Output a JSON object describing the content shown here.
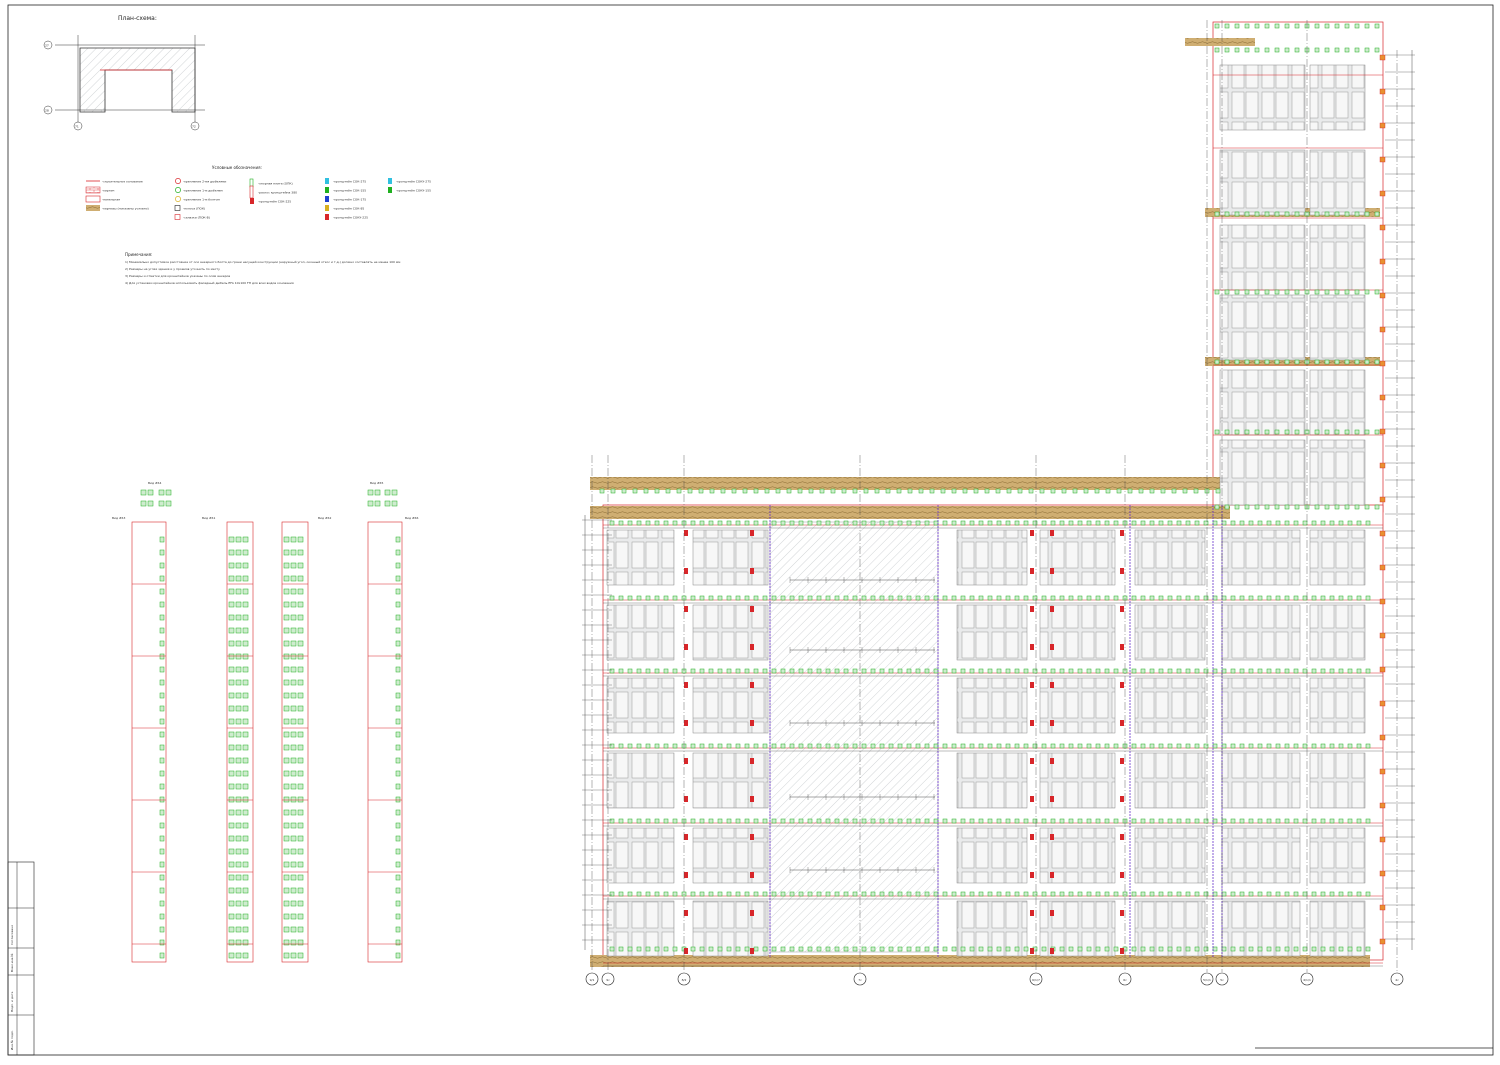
{
  "plan": {
    "title": "План-схема:",
    "grid_top": "27",
    "grid_bottom": "28",
    "grid_left": "71",
    "grid_right": "72"
  },
  "legend": {
    "title": "Условные обозначения:",
    "items": [
      {
        "text": "-строительное основание",
        "swatch": "line-red"
      },
      {
        "text": "-кирпич",
        "swatch": "brick"
      },
      {
        "text": "-панельная",
        "swatch": "panel"
      },
      {
        "text": "-карнизы (показаны условно)",
        "swatch": "wood"
      },
      {
        "text": "-крепление 2-мя дюбелями",
        "swatch": "circle-red"
      },
      {
        "text": "-крепление 1-м дюбелем",
        "swatch": "circle-green"
      },
      {
        "text": "-крепление 1-м болтом",
        "swatch": "circle-yellow"
      },
      {
        "text": "-полоса (ПОК)",
        "swatch": "square-black"
      },
      {
        "text": "-салазки (ПОК-В)",
        "swatch": "square-red"
      },
      {
        "text": "-опорная плита (ОПК)",
        "swatch": "rect-green"
      },
      {
        "text": "-раскос кронштейна 380",
        "swatch": "rect-red-tall"
      },
      {
        "text": "-кронштейн СОК-225",
        "swatch": "bracket-red"
      },
      {
        "text": "-кронштейн СОК-275",
        "swatch": "bracket-cyan"
      },
      {
        "text": "-кронштейн СОК-155",
        "swatch": "bracket-green"
      },
      {
        "text": "-кронштейн СОК-175",
        "swatch": "bracket-blue"
      },
      {
        "text": "-кронштейн СОК-85",
        "swatch": "bracket-yellow"
      },
      {
        "text": "-кронштейн СОКУ-225",
        "swatch": "bracket-red"
      },
      {
        "text": "-кронштейн СОКУ-275",
        "swatch": "bracket-cyan"
      },
      {
        "text": "-кронштейн СОКУ-155",
        "swatch": "bracket-green"
      }
    ]
  },
  "notes": {
    "title": "Примечания:",
    "lines": [
      "1) Минимально допустимое расстояние от оси анкерного болта до грани несущей конструкции (наружный угол, оконный откос и т.д.) должно составлять не менее 100 мм",
      "2) Размеры на углах здания и у проемов уточнить по месту",
      "3) Размеры и отметки для кронштейнов указаны по осям анкеров",
      "4) Для установки кронштейнов использовать фасадный дюбель EFA 10х100 FH для всех видов основания"
    ]
  },
  "views": [
    {
      "label": "Вид #63"
    },
    {
      "label": "Вид #61"
    },
    {
      "label": "Вид #62"
    },
    {
      "label": "Вид #64"
    },
    {
      "label": "Вид #65"
    },
    {
      "label": "Вид #66"
    }
  ],
  "axes": [
    "9/1",
    "9с",
    "8/2",
    "7с",
    "6/1/7",
    "6с",
    "5/1/1",
    "5с",
    "4/1/1",
    "4с"
  ],
  "stamp": {
    "col1": "Инв.№ подл.",
    "col2": "Подп. и дата",
    "col3": "Взам.инв.№",
    "col4": "Согласовано"
  },
  "colors": {
    "red": "#d8262a",
    "green": "#20b020",
    "wood": "#c8a56b",
    "hatch": "#9aa0a6",
    "purple": "#6633cc"
  }
}
